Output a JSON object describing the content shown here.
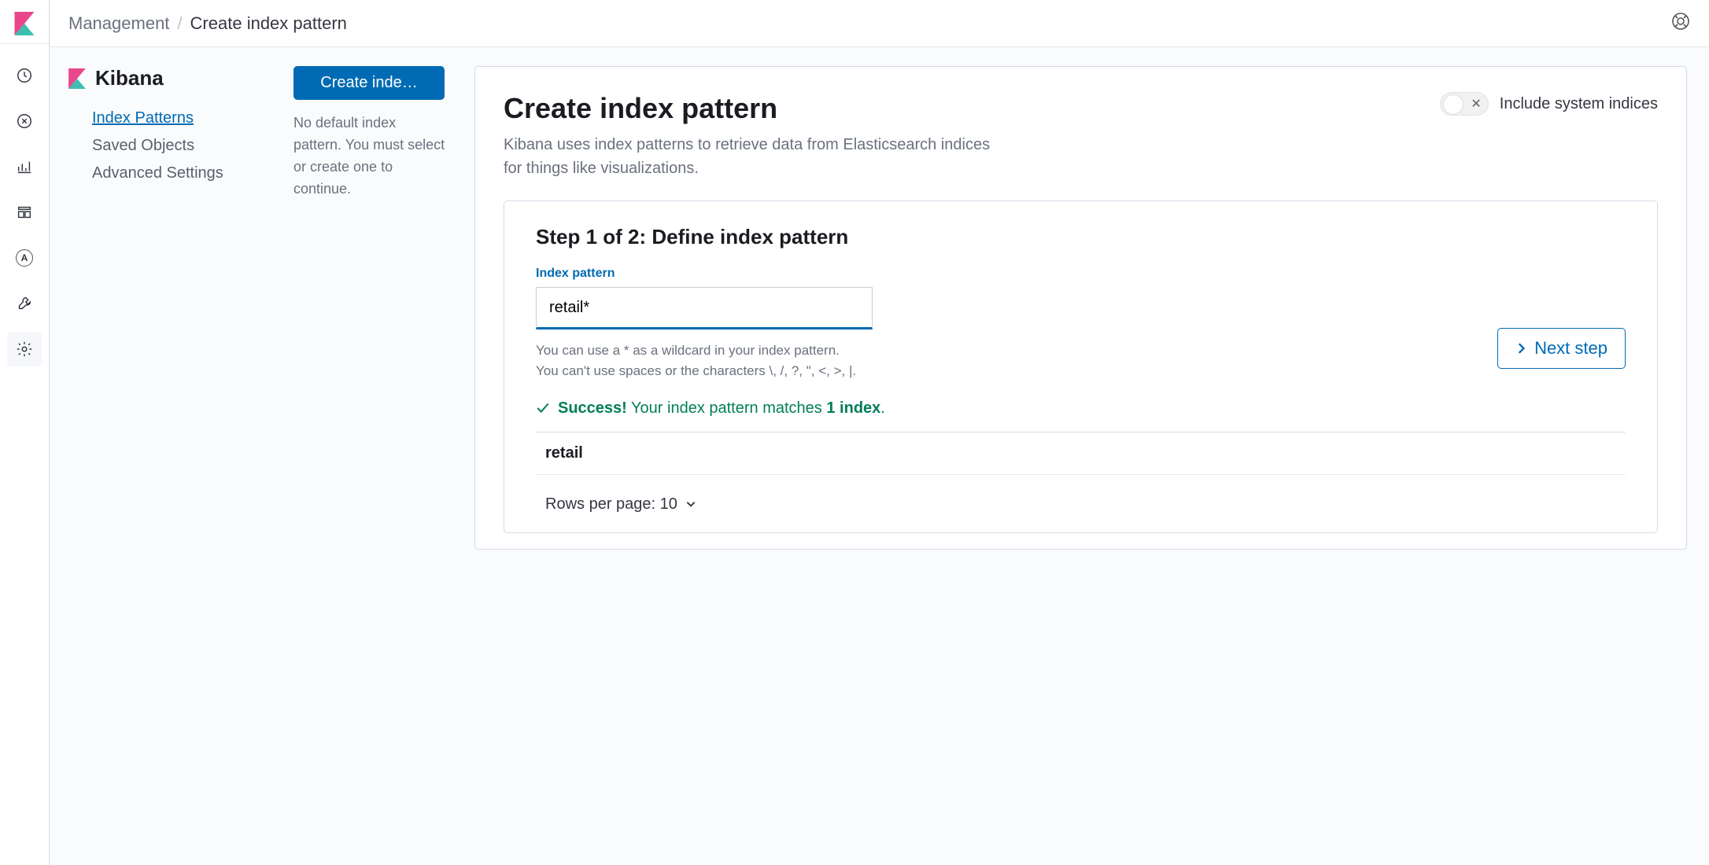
{
  "breadcrumb": {
    "root": "Management",
    "current": "Create index pattern"
  },
  "sidebar": {
    "title": "Kibana",
    "items": [
      {
        "label": "Index Patterns",
        "active": true
      },
      {
        "label": "Saved Objects",
        "active": false
      },
      {
        "label": "Advanced Settings",
        "active": false
      }
    ]
  },
  "action_col": {
    "create_button": "Create inde…",
    "notice": "No default index pattern. You must select or create one to continue."
  },
  "panel": {
    "title": "Create index pattern",
    "description": "Kibana uses index patterns to retrieve data from Elasticsearch indices for things like visualizations.",
    "include_system_label": "Include system indices"
  },
  "step": {
    "title": "Step 1 of 2: Define index pattern",
    "field_label": "Index pattern",
    "input_value": "retail*",
    "hint_line1": "You can use a * as a wildcard in your index pattern.",
    "hint_line2": "You can't use spaces or the characters \\, /, ?, \", <, >, |.",
    "next_button": "Next step",
    "success_lead": "Success!",
    "success_rest": "Your index pattern matches",
    "success_count": "1 index",
    "success_tail": ".",
    "matches": [
      {
        "name": "retail"
      }
    ],
    "rows_per_page": "Rows per page: 10"
  }
}
